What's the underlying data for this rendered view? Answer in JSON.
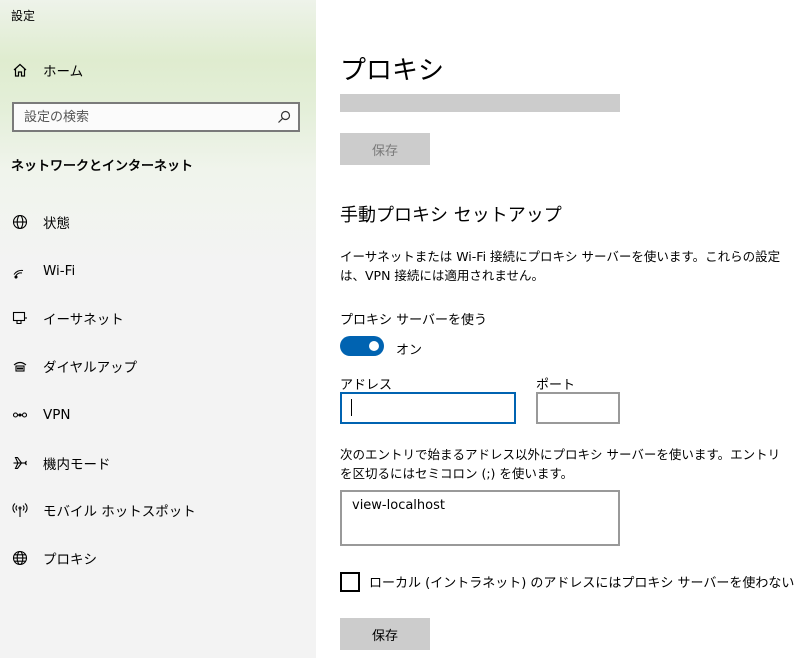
{
  "window": {
    "title": "設定"
  },
  "sidebar": {
    "home_label": "ホーム",
    "search": {
      "placeholder": "設定の検索"
    },
    "section_title": "ネットワークとインターネット",
    "items": [
      {
        "label": "状態",
        "icon": "globe-status-icon"
      },
      {
        "label": "Wi-Fi",
        "icon": "wifi-icon"
      },
      {
        "label": "イーサネット",
        "icon": "ethernet-icon"
      },
      {
        "label": "ダイヤルアップ",
        "icon": "dialup-icon"
      },
      {
        "label": "VPN",
        "icon": "vpn-icon"
      },
      {
        "label": "機内モード",
        "icon": "airplane-icon"
      },
      {
        "label": "モバイル ホットスポット",
        "icon": "hotspot-icon"
      },
      {
        "label": "プロキシ",
        "icon": "globe-icon"
      }
    ]
  },
  "main": {
    "title": "プロキシ",
    "top_save_label": "保存",
    "manual_heading": "手動プロキシ セットアップ",
    "manual_description": "イーサネットまたは Wi-Fi 接続にプロキシ サーバーを使います。これらの設定は、VPN 接続には適用されません。",
    "use_proxy_label": "プロキシ サーバーを使う",
    "toggle_state": "オン",
    "address_label": "アドレス",
    "address_value": "",
    "port_label": "ポート",
    "port_value": "",
    "exceptions_description": "次のエントリで始まるアドレス以外にプロキシ サーバーを使います。エントリを区切るにはセミコロン (;) を使います。",
    "exceptions_value": "view-localhost",
    "local_checkbox_label": "ローカル (イントラネット) のアドレスにはプロキシ サーバーを使わない",
    "save_label": "保存"
  },
  "colors": {
    "accent": "#0063b1",
    "button_gray": "#cccccc",
    "sidebar_bg": "#f3f3f3"
  }
}
